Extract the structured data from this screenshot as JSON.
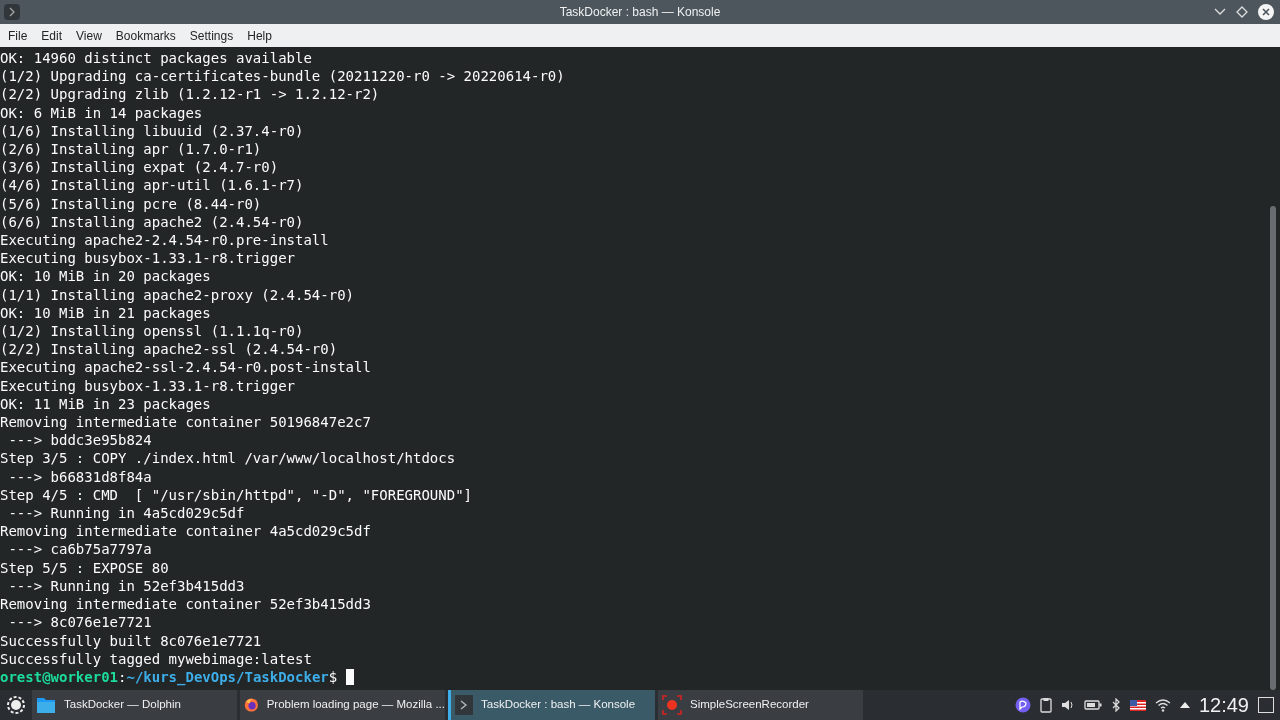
{
  "window": {
    "title": "TaskDocker : bash — Konsole"
  },
  "menu": [
    "File",
    "Edit",
    "View",
    "Bookmarks",
    "Settings",
    "Help"
  ],
  "terminal": {
    "lines": [
      "OK: 14960 distinct packages available",
      "(1/2) Upgrading ca-certificates-bundle (20211220-r0 -> 20220614-r0)",
      "(2/2) Upgrading zlib (1.2.12-r1 -> 1.2.12-r2)",
      "OK: 6 MiB in 14 packages",
      "(1/6) Installing libuuid (2.37.4-r0)",
      "(2/6) Installing apr (1.7.0-r1)",
      "(3/6) Installing expat (2.4.7-r0)",
      "(4/6) Installing apr-util (1.6.1-r7)",
      "(5/6) Installing pcre (8.44-r0)",
      "(6/6) Installing apache2 (2.4.54-r0)",
      "Executing apache2-2.4.54-r0.pre-install",
      "Executing busybox-1.33.1-r8.trigger",
      "OK: 10 MiB in 20 packages",
      "(1/1) Installing apache2-proxy (2.4.54-r0)",
      "OK: 10 MiB in 21 packages",
      "(1/2) Installing openssl (1.1.1q-r0)",
      "(2/2) Installing apache2-ssl (2.4.54-r0)",
      "Executing apache2-ssl-2.4.54-r0.post-install",
      "Executing busybox-1.33.1-r8.trigger",
      "OK: 11 MiB in 23 packages",
      "Removing intermediate container 50196847e2c7",
      " ---> bddc3e95b824",
      "Step 3/5 : COPY ./index.html /var/www/localhost/htdocs",
      " ---> b66831d8f84a",
      "Step 4/5 : CMD  [ \"/usr/sbin/httpd\", \"-D\", \"FOREGROUND\"]",
      " ---> Running in 4a5cd029c5df",
      "Removing intermediate container 4a5cd029c5df",
      " ---> ca6b75a7797a",
      "Step 5/5 : EXPOSE 80",
      " ---> Running in 52ef3b415dd3",
      "Removing intermediate container 52ef3b415dd3",
      " ---> 8c076e1e7721",
      "Successfully built 8c076e1e7721",
      "Successfully tagged mywebimage:latest"
    ],
    "prompt": {
      "user_host": "orest@worker01",
      "separator": ":",
      "path": "~/kurs_DevOps/TaskDocker",
      "symbol": "$"
    }
  },
  "taskbar": {
    "tasks": [
      {
        "kind": "folder",
        "label": "TaskDocker — Dolphin",
        "selected": false
      },
      {
        "kind": "browser",
        "label": "Problem loading page — Mozilla ...",
        "selected": false
      },
      {
        "kind": "terminal",
        "label": "TaskDocker : bash — Konsole",
        "selected": true
      },
      {
        "kind": "recorder",
        "label": "SimpleScreenRecorder",
        "selected": false
      }
    ],
    "clock": "12:49"
  }
}
